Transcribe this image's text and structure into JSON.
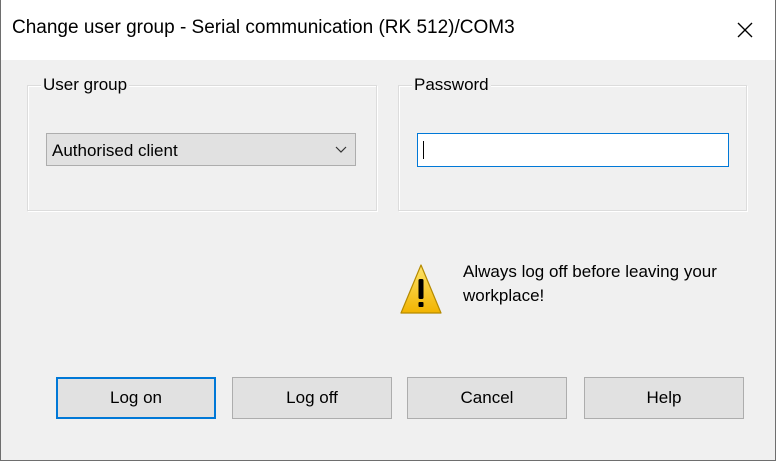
{
  "window": {
    "title": "Change user group - Serial communication (RK 512)/COM3",
    "close_icon": "close-icon"
  },
  "user_group": {
    "label": "User group",
    "selected": "Authorised client",
    "dropdown_icon": "chevron-down-icon"
  },
  "password": {
    "label": "Password",
    "value": ""
  },
  "warning": {
    "icon": "warning-icon",
    "text": "Always log off before leaving your workplace!"
  },
  "buttons": {
    "log_on": "Log on",
    "log_off": "Log off",
    "cancel": "Cancel",
    "help": "Help"
  },
  "colors": {
    "focus_accent": "#0078d7",
    "warning_yellow": "#f7c600"
  }
}
